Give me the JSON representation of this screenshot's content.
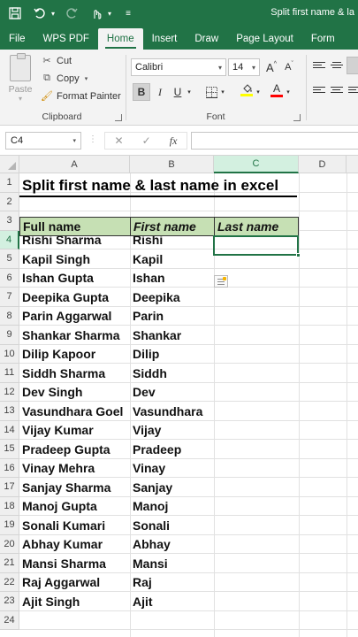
{
  "window": {
    "title": "Split first name & la"
  },
  "tabs": [
    "File",
    "WPS PDF",
    "Home",
    "Insert",
    "Draw",
    "Page Layout",
    "Form"
  ],
  "active_tab": "Home",
  "clipboard": {
    "paste_label": "Paste",
    "cut_label": "Cut",
    "copy_label": "Copy",
    "format_painter_label": "Format Painter",
    "group_label": "Clipboard"
  },
  "font": {
    "name": "Calibri",
    "size": "14",
    "group_label": "Font",
    "grow_label": "A",
    "shrink_label": "A",
    "bold_label": "B",
    "italic_label": "I",
    "underline_label": "U",
    "font_color_label": "A",
    "highlight_color": "#ffff00",
    "font_color": "#ff0000"
  },
  "formula_bar": {
    "name_box": "C4",
    "fx_label": "fx",
    "cancel_label": "✕",
    "enter_label": "✓",
    "value": ""
  },
  "columns": [
    "A",
    "B",
    "C",
    "D"
  ],
  "selected_column": "C",
  "selected_row": "4",
  "rows": [
    "1",
    "2",
    "3",
    "4",
    "5",
    "6",
    "7",
    "8",
    "9",
    "10",
    "11",
    "12",
    "13",
    "14",
    "15",
    "16",
    "17",
    "18",
    "19",
    "20",
    "21",
    "22",
    "23",
    "24"
  ],
  "sheet": {
    "title": "Split first name & last name in excel",
    "headers": [
      "Full name",
      "First name",
      "Last name"
    ],
    "data": [
      [
        "Rishi Sharma",
        "Rishi"
      ],
      [
        "Kapil Singh",
        "Kapil"
      ],
      [
        "Ishan Gupta",
        "Ishan"
      ],
      [
        "Deepika Gupta",
        "Deepika"
      ],
      [
        "Parin Aggarwal",
        "Parin"
      ],
      [
        "Shankar Sharma",
        "Shankar"
      ],
      [
        "Dilip Kapoor",
        "Dilip"
      ],
      [
        "Siddh Sharma",
        "Siddh"
      ],
      [
        "Dev Singh",
        "Dev"
      ],
      [
        "Vasundhara Goel",
        "Vasundhara"
      ],
      [
        "Vijay Kumar",
        "Vijay"
      ],
      [
        "Pradeep Gupta",
        "Pradeep"
      ],
      [
        "Vinay Mehra",
        "Vinay"
      ],
      [
        "Sanjay Sharma",
        "Sanjay"
      ],
      [
        "Manoj Gupta",
        "Manoj"
      ],
      [
        "Sonali Kumari",
        "Sonali"
      ],
      [
        "Abhay Kumar",
        "Abhay"
      ],
      [
        "Mansi Sharma",
        "Mansi"
      ],
      [
        "Raj Aggarwal",
        "Raj"
      ],
      [
        "Ajit Singh",
        "Ajit"
      ]
    ]
  },
  "colors": {
    "brand": "#217346",
    "header_fill": "#c6e0b4"
  }
}
